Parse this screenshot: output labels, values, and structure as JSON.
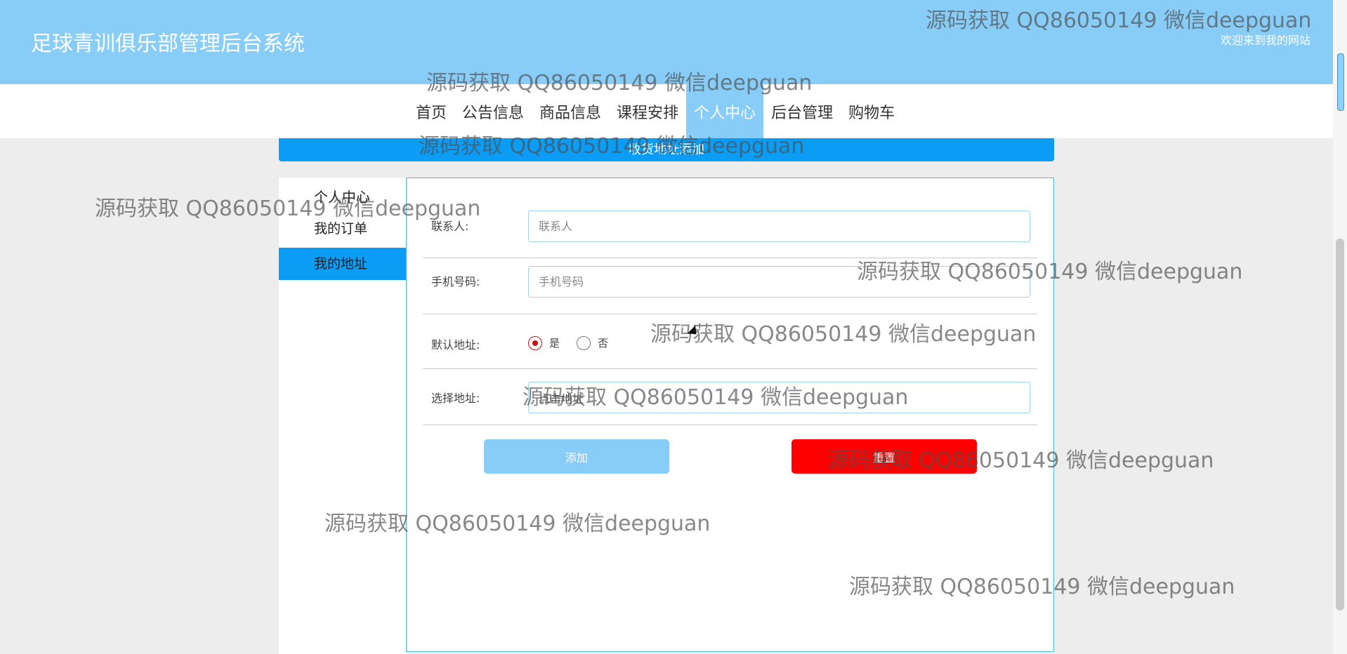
{
  "header": {
    "site_title": "足球青训俱乐部管理后台系统",
    "welcome": "欢迎来到我的网站"
  },
  "nav": {
    "items": [
      {
        "label": "首页"
      },
      {
        "label": "公告信息"
      },
      {
        "label": "商品信息"
      },
      {
        "label": "课程安排"
      },
      {
        "label": "个人中心",
        "active": true
      },
      {
        "label": "后台管理"
      },
      {
        "label": "购物车"
      }
    ]
  },
  "band": {
    "text": "收货地址添加"
  },
  "sidebar": {
    "title": "个人中心",
    "items": [
      {
        "label": "我的订单"
      },
      {
        "label": "我的地址",
        "active": true
      }
    ]
  },
  "form": {
    "contact": {
      "label": "联系人:",
      "placeholder": "联系人",
      "value": ""
    },
    "phone": {
      "label": "手机号码:",
      "placeholder": "手机号码",
      "value": ""
    },
    "default": {
      "label": "默认地址:",
      "options": [
        "是",
        "否"
      ],
      "selected": "是"
    },
    "address": {
      "label": "选择地址:",
      "placeholder": "",
      "value": "点击地址"
    },
    "add_button": "添加",
    "reset_button": "重置"
  },
  "watermark": {
    "text": "源码获取 QQ86050149 微信deepguan"
  },
  "colors": {
    "header": "#87cdf8",
    "accent": "#0b9cf5",
    "reset": "#ff0000",
    "radio": "#c71010"
  }
}
